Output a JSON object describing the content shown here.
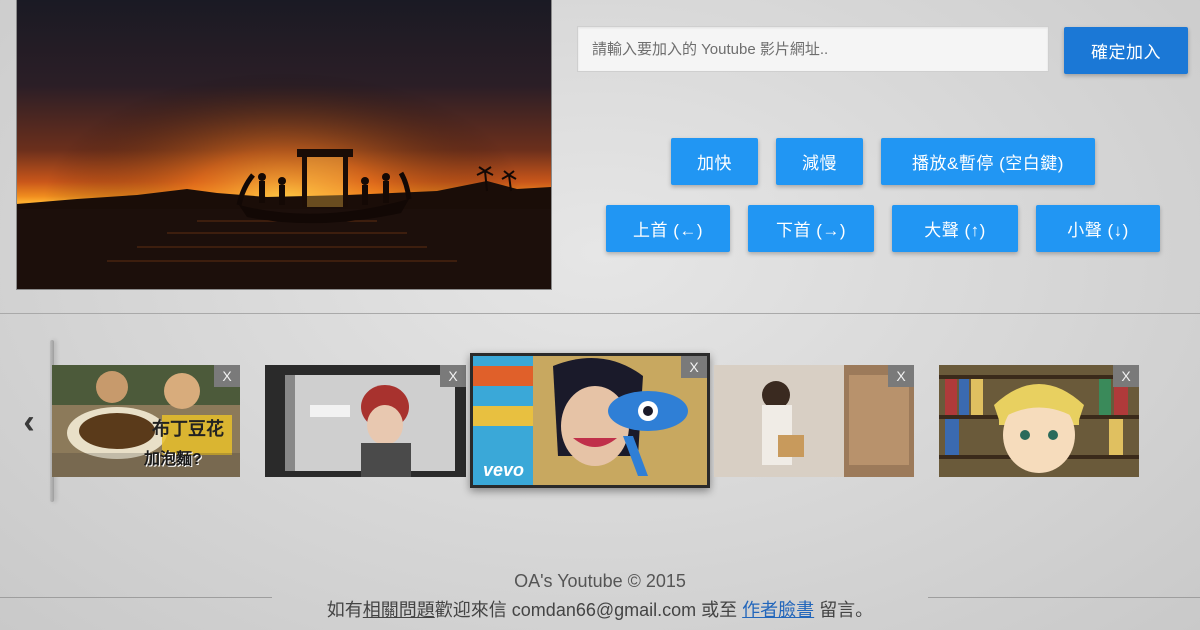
{
  "player": {
    "description": "video-player"
  },
  "url_form": {
    "placeholder": "請輸入要加入的 Youtube 影片網址..",
    "value": "",
    "confirm_label": "確定加入"
  },
  "controls": {
    "row1": [
      "加快",
      "減慢",
      "播放&暫停 (空白鍵)"
    ],
    "row2": [
      "上首 (←)",
      "下首 (→)",
      "大聲 (↑)",
      "小聲 (↓)"
    ]
  },
  "playlist": {
    "prev_icon": "‹",
    "close_label": "X",
    "items": [
      {
        "caption": "加泡麵?",
        "overlay": "布丁豆花"
      },
      {
        "caption": ""
      },
      {
        "caption": "vevo",
        "active": true
      },
      {
        "caption": ""
      },
      {
        "caption": ""
      }
    ]
  },
  "footer": {
    "title": "OA's Youtube © 2015",
    "prefix": "如有",
    "faq_link": "相關問題",
    "middle": "歡迎來信 comdan66@gmail.com 或至",
    "fb_link": "作者臉書",
    "suffix": "留言。"
  },
  "colors": {
    "primary": "#2196f3",
    "confirm": "#1b78d6",
    "link": "#2266bb"
  }
}
